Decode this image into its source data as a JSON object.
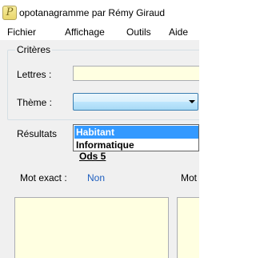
{
  "window": {
    "title": "opotanagramme par Rémy Giraud",
    "icon_name": "app-logo-icon",
    "icon_glyph": "P"
  },
  "menu": {
    "items": [
      "Fichier",
      "Affichage",
      "Outils",
      "Aide"
    ]
  },
  "criteria": {
    "legend": "Critères",
    "letters_label": "Lettres :",
    "letters_value": "",
    "theme_label": "Thème :",
    "theme_value": "",
    "theme_options": [
      "Habitant",
      "Informatique"
    ],
    "theme_highlighted": "Habitant"
  },
  "results": {
    "label": "Résultats",
    "dictionary_label": "Ods 5",
    "exact_word_label": "Mot exact :",
    "exact_word_value": "Non",
    "second_column_label": "Mot"
  },
  "colors": {
    "input_background": "#ffffe1",
    "highlight": "#3399ff",
    "link_blue": "#1f5fbf"
  }
}
